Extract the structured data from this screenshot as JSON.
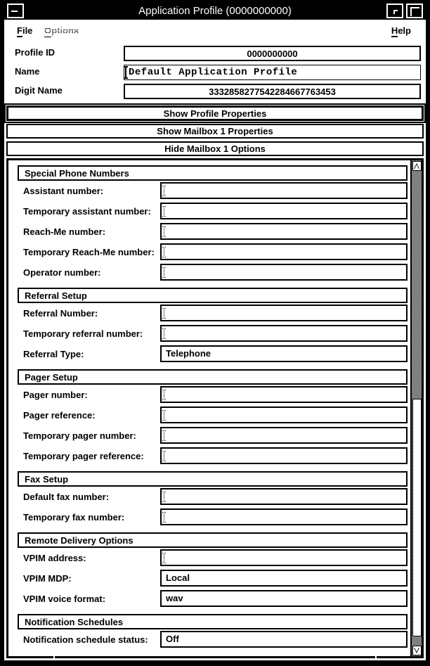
{
  "window": {
    "title": "Application Profile (0000000000)",
    "minimize_label": "minimize",
    "restore_label": "restore",
    "maximize_label": "maximize"
  },
  "menubar": {
    "items": [
      {
        "label": "File",
        "mnemonic": "F",
        "rest": "ile",
        "enabled": true
      },
      {
        "label": "Options",
        "mnemonic": "O",
        "rest": "ptions",
        "enabled": false
      },
      {
        "label": "Help",
        "mnemonic": "H",
        "rest": "elp",
        "enabled": true
      }
    ]
  },
  "header_form": {
    "rows": [
      {
        "label": "Profile ID",
        "value": "0000000000"
      },
      {
        "label": "Name",
        "value": "Default Application Profile"
      },
      {
        "label": "Digit Name",
        "value": "3332858277542284667763453"
      }
    ]
  },
  "action_buttons": [
    {
      "label": "Show Profile Properties",
      "is_default": true
    },
    {
      "label": "Show Mailbox 1 Properties",
      "is_default": false
    },
    {
      "label": "Hide Mailbox 1 Options",
      "is_default": false
    }
  ],
  "panel": {
    "sections": [
      {
        "title": "Special Phone Numbers",
        "fields": [
          {
            "label": "Assistant number:",
            "value": ""
          },
          {
            "label": "Temporary assistant number:",
            "value": ""
          },
          {
            "label": "Reach-Me number:",
            "value": ""
          },
          {
            "label": "Temporary Reach-Me number:",
            "value": ""
          },
          {
            "label": "Operator number:",
            "value": ""
          }
        ]
      },
      {
        "title": "Referral Setup",
        "fields": [
          {
            "label": "Referral Number:",
            "value": ""
          },
          {
            "label": "Temporary referral number:",
            "value": ""
          },
          {
            "label": "Referral Type:",
            "value": "Telephone"
          }
        ]
      },
      {
        "title": "Pager Setup",
        "fields": [
          {
            "label": "Pager number:",
            "value": ""
          },
          {
            "label": "Pager reference:",
            "value": ""
          },
          {
            "label": "Temporary pager number:",
            "value": ""
          },
          {
            "label": "Temporary pager reference:",
            "value": ""
          }
        ]
      },
      {
        "title": "Fax Setup",
        "fields": [
          {
            "label": "Default fax number:",
            "value": ""
          },
          {
            "label": "Temporary fax number:",
            "value": ""
          }
        ]
      },
      {
        "title": "Remote Delivery Options",
        "fields": [
          {
            "label": "VPIM address:",
            "value": ""
          },
          {
            "label": "VPIM MDP:",
            "value": "Local"
          },
          {
            "label": "VPIM voice format:",
            "value": "wav"
          }
        ]
      },
      {
        "title": "Notification Schedules",
        "fields": [
          {
            "label": "Notification schedule status:",
            "value": "Off"
          }
        ]
      }
    ],
    "scrollbar": {
      "up_arrow": "scroll-up",
      "down_arrow": "scroll-down",
      "thumb_top_pct": 48,
      "thumb_height_pct": 50
    }
  },
  "colors": {
    "background": "#ffffff",
    "foreground": "#000000",
    "titlebar_bg": "#000000",
    "titlebar_fg": "#ffffff"
  }
}
